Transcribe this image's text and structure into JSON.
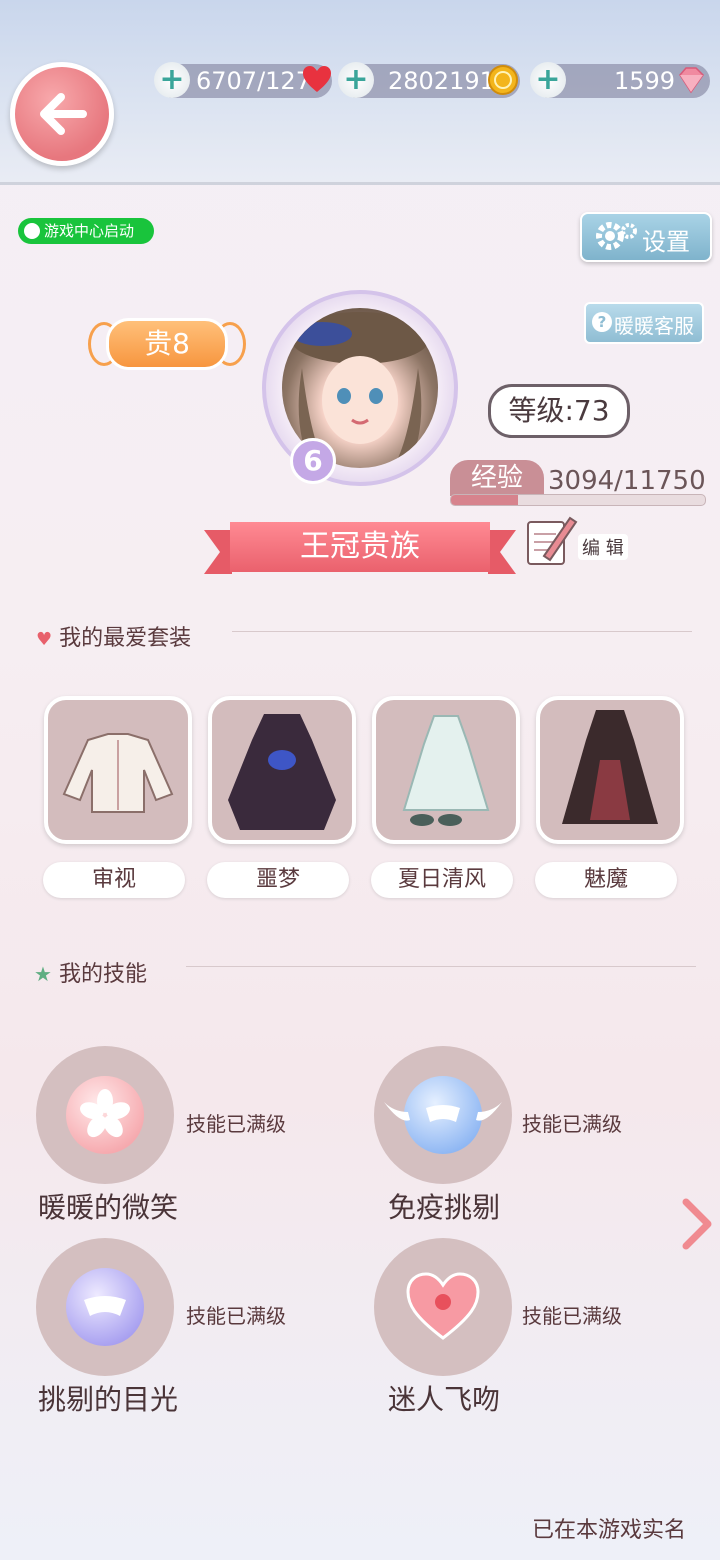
{
  "resources": {
    "stamina": "6707/127",
    "gold": "2802191",
    "diamond": "1599"
  },
  "badges": {
    "game_center": "游戏中心启动",
    "settings": "设置",
    "customer_service": "暖暖客服"
  },
  "profile": {
    "vip": "贵8",
    "avatar_rank": "6",
    "level": "等级:73",
    "exp_label": "经验",
    "exp_value": "3094/11750",
    "exp_progress": 0.263,
    "title": "王冠贵族",
    "edit": "编 辑"
  },
  "favorites": {
    "heading": "我的最爱套装",
    "items": [
      {
        "label": "审视"
      },
      {
        "label": "噩梦"
      },
      {
        "label": "夏日清风"
      },
      {
        "label": "魅魔"
      }
    ]
  },
  "skills": {
    "heading": "我的技能",
    "items": [
      {
        "name": "暖暖的微笑",
        "status": "技能已满级",
        "icon": "sakura-icon",
        "color": "#f6a9ae"
      },
      {
        "name": "免疫挑剔",
        "status": "技能已满级",
        "icon": "winged-mask-icon",
        "color": "#8fb7f3"
      },
      {
        "name": "挑剔的目光",
        "status": "技能已满级",
        "icon": "mask-icon",
        "color": "#a8a0f0"
      },
      {
        "name": "迷人飞吻",
        "status": "技能已满级",
        "icon": "heart-icon",
        "color": "#f79aa3"
      }
    ]
  },
  "footer": {
    "realname": "已在本游戏实名"
  }
}
